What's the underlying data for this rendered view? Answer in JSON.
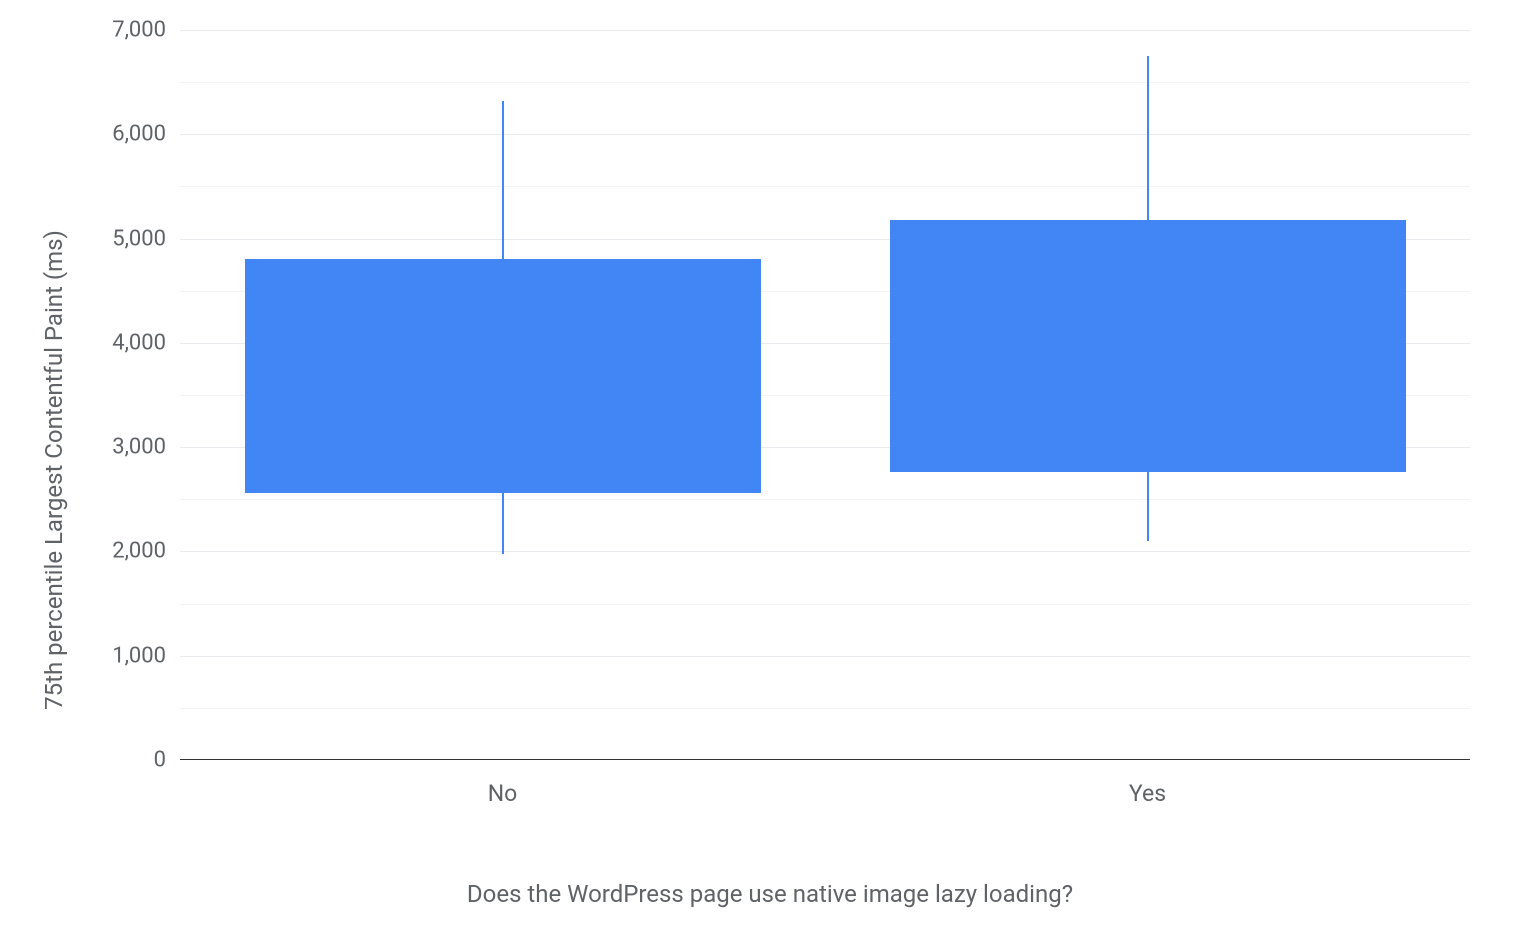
{
  "chart_data": {
    "type": "boxplot",
    "xlabel": "Does the WordPress page use native image lazy loading?",
    "ylabel": "75th percentile Largest Contentful Paint (ms)",
    "ylim": [
      0,
      7000
    ],
    "y_ticks": [
      0,
      1000,
      2000,
      3000,
      4000,
      5000,
      6000,
      7000
    ],
    "y_tick_labels": [
      "0",
      "1,000",
      "2,000",
      "3,000",
      "4,000",
      "5,000",
      "6,000",
      "7,000"
    ],
    "categories": [
      "No",
      "Yes"
    ],
    "series": [
      {
        "category": "No",
        "whisker_low": 1980,
        "q1": 2560,
        "q3": 4800,
        "whisker_high": 6320
      },
      {
        "category": "Yes",
        "whisker_low": 2100,
        "q1": 2760,
        "q3": 5180,
        "whisker_high": 6750
      }
    ],
    "bar_color": "#4285f4"
  }
}
